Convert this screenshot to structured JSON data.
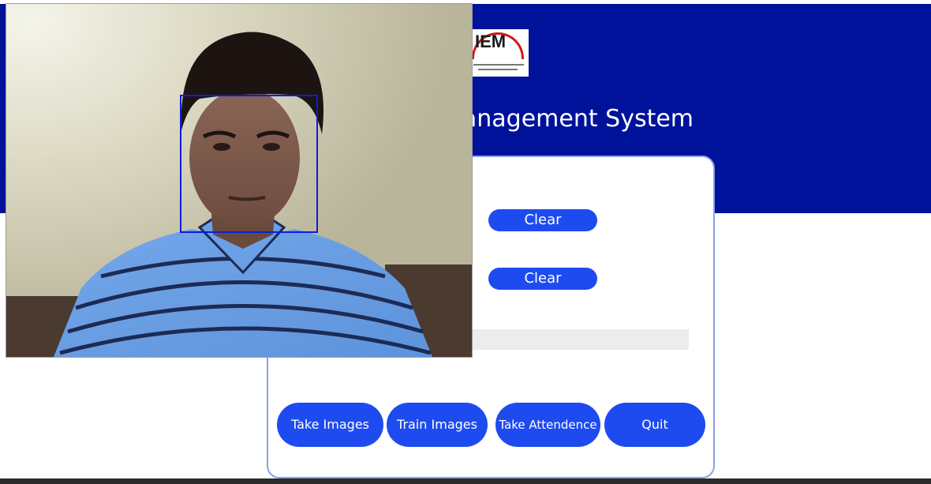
{
  "app": {
    "title": "Management System",
    "logo_text": "IEM",
    "accent_color": "#1e4bf0",
    "header_color": "#00129a"
  },
  "form": {
    "clear_buttons": [
      "Clear",
      "Clear"
    ]
  },
  "actions": {
    "take_images": "Take Images",
    "train_images": "Train Images",
    "take_attendance": "Take Attendence",
    "quit": "Quit"
  },
  "camera": {
    "face_box_color": "#0a1de0"
  }
}
